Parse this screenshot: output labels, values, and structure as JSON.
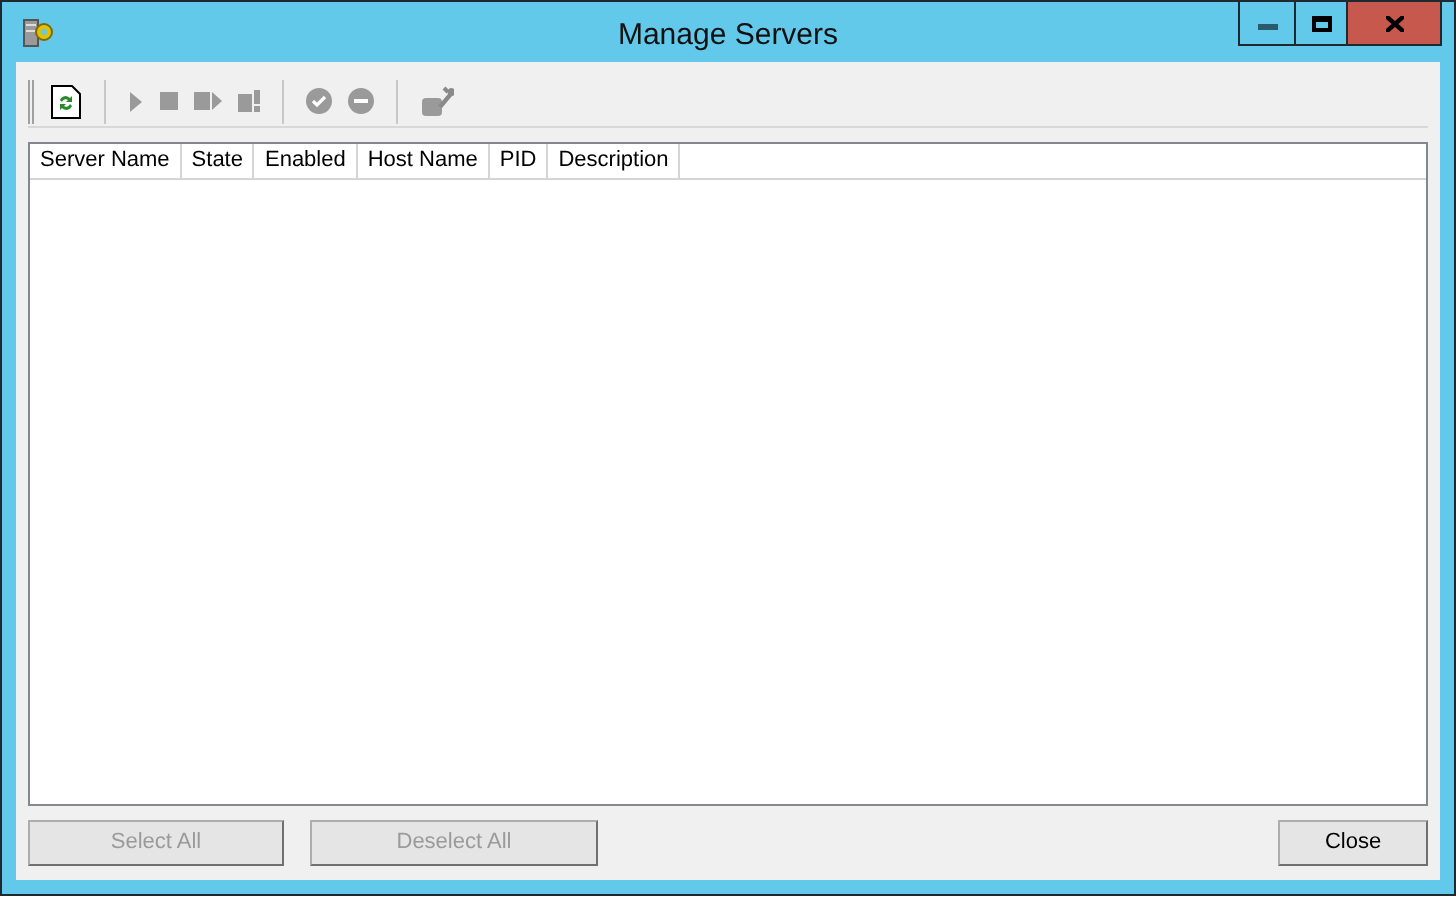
{
  "window": {
    "title": "Manage Servers"
  },
  "toolbar": [
    {
      "kind": "refresh",
      "disabled": false
    },
    {
      "kind": "separator"
    },
    {
      "kind": "start",
      "disabled": true
    },
    {
      "kind": "stop",
      "disabled": true
    },
    {
      "kind": "restart",
      "disabled": true
    },
    {
      "kind": "kill",
      "disabled": true
    },
    {
      "kind": "separator"
    },
    {
      "kind": "enable",
      "disabled": true
    },
    {
      "kind": "disable",
      "disabled": true
    },
    {
      "kind": "separator"
    },
    {
      "kind": "configure",
      "disabled": true
    }
  ],
  "table": {
    "columns": [
      "Server Name",
      "State",
      "Enabled",
      "Host Name",
      "PID",
      "Description"
    ]
  },
  "buttons": [
    {
      "label": "Select All",
      "disabled": true
    },
    {
      "label": "Deselect All",
      "disabled": true
    },
    {
      "label": "Close",
      "disabled": false
    }
  ]
}
